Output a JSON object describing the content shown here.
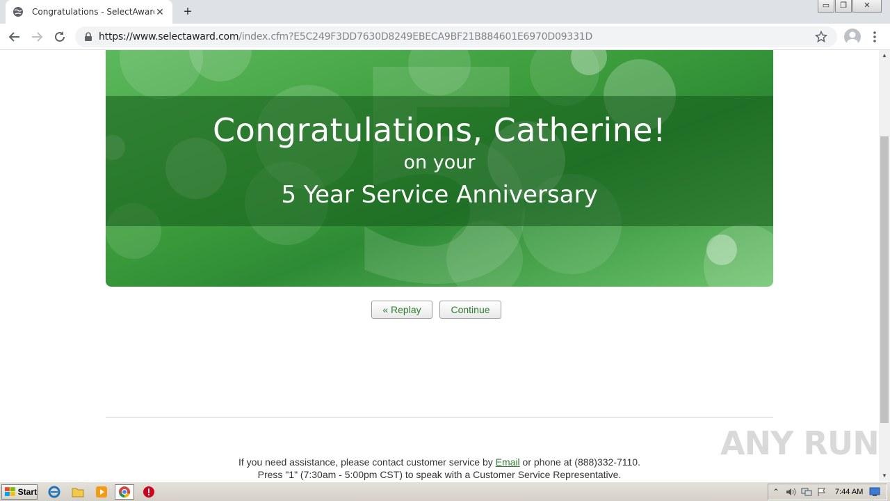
{
  "browser": {
    "tab_title": "Congratulations - SelectAward.com",
    "tab_close": "✕",
    "new_tab": "+",
    "url_host": "https://www.selectaward.com",
    "url_path": "/index.cfm?E5C249F3DD7630D8249EBECA9BF21B884601E6970D09331D",
    "window": {
      "minimize": "▭",
      "restore": "❐",
      "close": "✕"
    }
  },
  "banner": {
    "title": "Congratulations, Catherine!",
    "subtitle": "on your",
    "anniversary": "5 Year Service Anniversary",
    "big_numeral": "5"
  },
  "actions": {
    "replay_label": "« Replay",
    "continue_label": "Continue"
  },
  "footer": {
    "line1_before": "If you need assistance, please contact customer service by ",
    "line1_link": "Email",
    "line1_after": " or phone at (888)332-7110.",
    "line2": "Press \"1\" (7:30am - 5:00pm CST) to speak with a Customer Service Representative."
  },
  "watermark": "ANY RUN",
  "taskbar": {
    "start_label": "Start",
    "clock": "7:44 AM",
    "tray_expand": "⌃"
  },
  "colors": {
    "accent_green": "#2e7d32",
    "banner_green": "#3c9d3c"
  }
}
